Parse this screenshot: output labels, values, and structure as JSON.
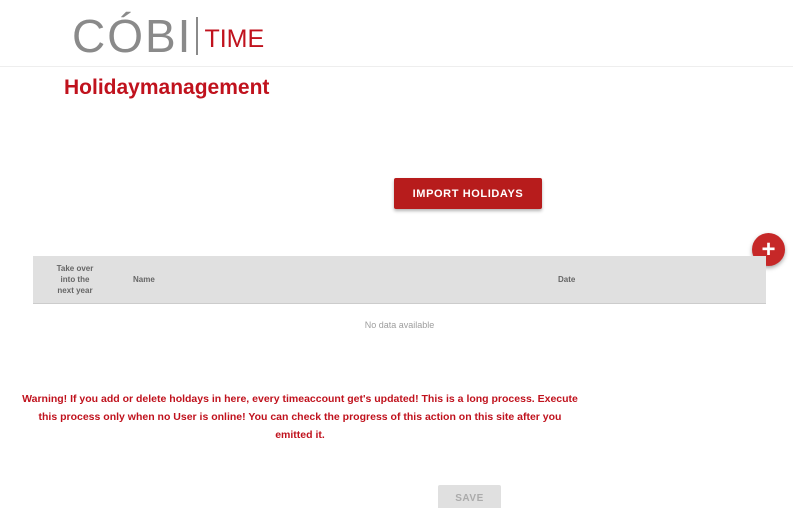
{
  "brand": {
    "logo_main": "CÓBI",
    "logo_sub": "TIME",
    "accent_color": "#c0121d"
  },
  "page": {
    "title": "Holidaymanagement"
  },
  "actions": {
    "import_label": "IMPORT HOLIDAYS",
    "add_label": "+",
    "save_label": "SAVE"
  },
  "table": {
    "columns": {
      "takeover": [
        "Take over",
        "into the",
        "next year"
      ],
      "name": "Name",
      "date": "Date"
    },
    "empty_text": "No data available"
  },
  "warning": {
    "text": "Warning! If you add or delete holdays in here, every timeaccount get's updated! This is a long process. Execute this process only when no User is online! You can check the progress of this action on this site after you emitted it."
  }
}
